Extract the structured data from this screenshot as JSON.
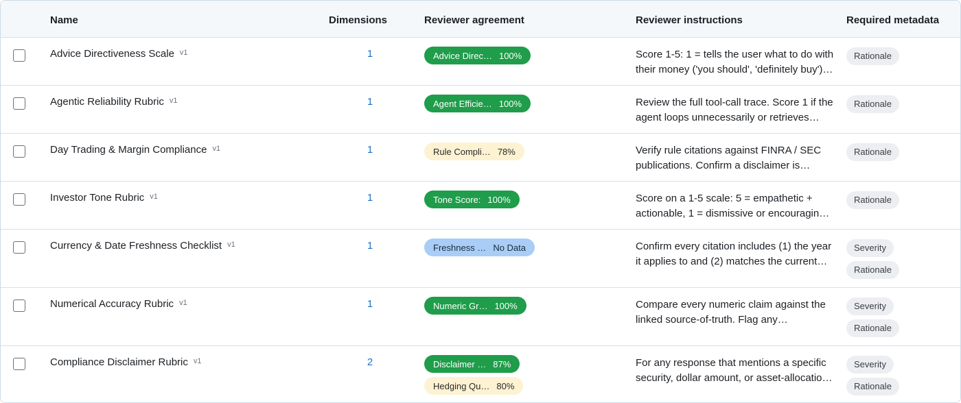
{
  "table": {
    "headers": {
      "name": "Name",
      "dimensions": "Dimensions",
      "agreement": "Reviewer agreement",
      "instructions": "Reviewer instructions",
      "metadata": "Required metadata"
    },
    "rows": [
      {
        "name": "Advice Directiveness Scale",
        "version": "v1",
        "dimensions": "1",
        "badges": [
          {
            "label": "Advice Direc…",
            "value": "100%",
            "tone": "green"
          }
        ],
        "instructions": [
          "Score 1-5: 1 = tells the user what to do with",
          "their money ('you should', 'definitely buy')…"
        ],
        "metadata": [
          "Rationale"
        ]
      },
      {
        "name": "Agentic Reliability Rubric",
        "version": "v1",
        "dimensions": "1",
        "badges": [
          {
            "label": "Agent Efficie…",
            "value": "100%",
            "tone": "green"
          }
        ],
        "instructions": [
          "Review the full tool-call trace. Score 1 if the",
          "agent loops unnecessarily or retrieves…"
        ],
        "metadata": [
          "Rationale"
        ]
      },
      {
        "name": "Day Trading & Margin Compliance",
        "version": "v1",
        "dimensions": "1",
        "badges": [
          {
            "label": "Rule Compli…",
            "value": "78%",
            "tone": "yellow"
          }
        ],
        "instructions": [
          "Verify rule citations against FINRA / SEC",
          "publications. Confirm a disclaimer is…"
        ],
        "metadata": [
          "Rationale"
        ]
      },
      {
        "name": "Investor Tone Rubric",
        "version": "v1",
        "dimensions": "1",
        "badges": [
          {
            "label": "Tone Score:",
            "value": "100%",
            "tone": "green"
          }
        ],
        "instructions": [
          "Score on a 1-5 scale: 5 = empathetic +",
          "actionable, 1 = dismissive or encouragin…"
        ],
        "metadata": [
          "Rationale"
        ]
      },
      {
        "name": "Currency & Date Freshness Checklist",
        "version": "v1",
        "dimensions": "1",
        "badges": [
          {
            "label": "Freshness …",
            "value": "No Data",
            "tone": "blue"
          }
        ],
        "instructions": [
          "Confirm every citation includes (1) the year",
          "it applies to and (2) matches the current…"
        ],
        "metadata": [
          "Severity",
          "Rationale"
        ]
      },
      {
        "name": "Numerical Accuracy Rubric",
        "version": "v1",
        "dimensions": "1",
        "badges": [
          {
            "label": "Numeric Gr…",
            "value": "100%",
            "tone": "green"
          }
        ],
        "instructions": [
          "Compare every numeric claim against the",
          "linked source-of-truth. Flag any…"
        ],
        "metadata": [
          "Severity",
          "Rationale"
        ]
      },
      {
        "name": "Compliance Disclaimer Rubric",
        "version": "v1",
        "dimensions": "2",
        "badges": [
          {
            "label": "Disclaimer …",
            "value": "87%",
            "tone": "green"
          },
          {
            "label": "Hedging Qu…",
            "value": "80%",
            "tone": "yellow"
          }
        ],
        "instructions": [
          "For any response that mentions a specific",
          "security, dollar amount, or asset-allocatio…"
        ],
        "metadata": [
          "Severity",
          "Rationale"
        ]
      }
    ]
  }
}
